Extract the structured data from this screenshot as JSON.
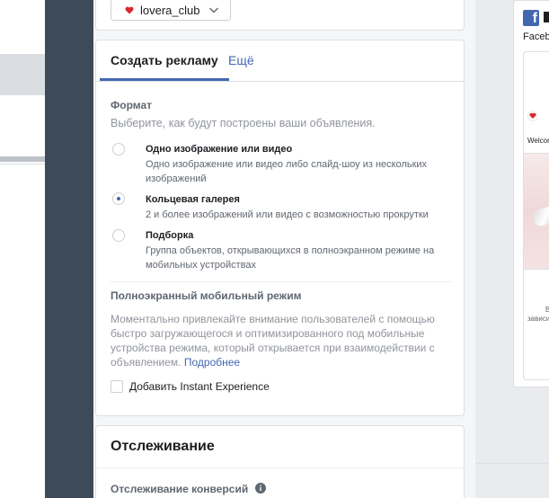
{
  "account": {
    "name": "lovera_club"
  },
  "tabs": {
    "create": "Создать рекламу",
    "more": "Ещё"
  },
  "format": {
    "heading": "Формат",
    "subtitle": "Выберите, как будут построены ваши объявления.",
    "options": [
      {
        "title": "Одно изображение или видео",
        "desc": "Одно изображение или видео либо слайд-шоу из нескольких изображений",
        "selected": false
      },
      {
        "title": "Кольцевая галерея",
        "desc": "2 и более изображений или видео с возможностью прокрутки",
        "selected": true
      },
      {
        "title": "Подборка",
        "desc": "Группа объектов, открывающихся в полноэкранном режиме на мобильных устройствах",
        "selected": false
      }
    ]
  },
  "fullscreen": {
    "heading": "Полноэкранный мобильный режим",
    "text": "Моментально привлекайте внимание пользователей с помощью быстро загружающегося и оптимизированного под мобильные устройства режима, который открывается при взаимодействии с объявлением.",
    "link": "Подробнее",
    "checkbox_label": "Добавить Instant Experience"
  },
  "tracking": {
    "title": "Отслеживание",
    "conversion_label": "Отслеживание конверсий"
  },
  "preview": {
    "platform": "Facebook",
    "welcome": "Welcome",
    "caption1": "B",
    "caption2": "зависи"
  },
  "colors": {
    "accent": "#4267b2",
    "dark_band": "#3d4a59",
    "brand_red": "#d8272d"
  },
  "icons": {
    "info": "info-icon",
    "chevron": "chevron-down-icon",
    "facebook": "facebook-icon"
  }
}
